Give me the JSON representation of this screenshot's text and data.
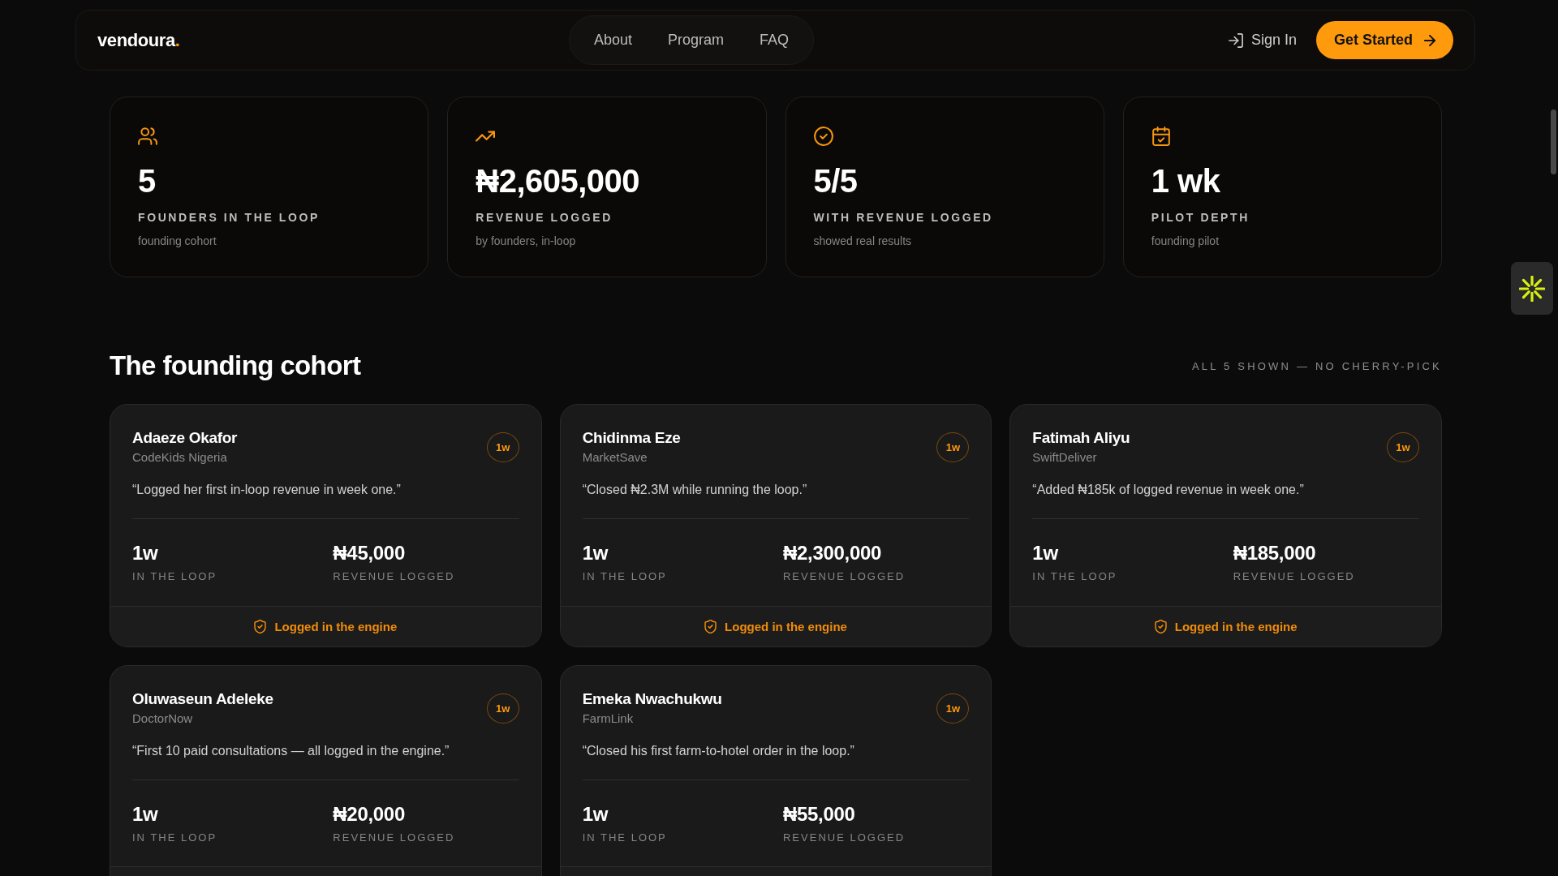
{
  "nav": {
    "logo": {
      "text": "vendoura",
      "mark": "."
    },
    "links": [
      {
        "label": "About"
      },
      {
        "label": "Program"
      },
      {
        "label": "FAQ"
      }
    ],
    "sign_in": "Sign In",
    "cta": "Get Started"
  },
  "stats": [
    {
      "value": "5",
      "label": "FOUNDERS IN THE LOOP",
      "sub": "founding cohort"
    },
    {
      "value": "₦2,605,000",
      "label": "REVENUE LOGGED",
      "sub": "by founders, in-loop"
    },
    {
      "value": "5/5",
      "label": "WITH REVENUE LOGGED",
      "sub": "showed real results"
    },
    {
      "value": "1 wk",
      "label": "PILOT DEPTH",
      "sub": "founding pilot"
    }
  ],
  "cohort": {
    "title": "The founding cohort",
    "note": "ALL 5 SHOWN — NO CHERRY-PICK",
    "founders": [
      {
        "name": "Adaeze Okafor",
        "company": "CodeKids Nigeria",
        "badge": "1w",
        "quote": "“Logged her first in-loop revenue in week one.”",
        "stats": [
          {
            "value": "1w",
            "label": "IN THE LOOP"
          },
          {
            "value": "₦45,000",
            "label": "REVENUE LOGGED"
          }
        ],
        "footer": "Logged in the engine"
      },
      {
        "name": "Chidinma Eze",
        "company": "MarketSave",
        "badge": "1w",
        "quote": "“Closed ₦2.3M while running the loop.”",
        "stats": [
          {
            "value": "1w",
            "label": "IN THE LOOP"
          },
          {
            "value": "₦2,300,000",
            "label": "REVENUE LOGGED"
          }
        ],
        "footer": "Logged in the engine"
      },
      {
        "name": "Fatimah Aliyu",
        "company": "SwiftDeliver",
        "badge": "1w",
        "quote": "“Added ₦185k of logged revenue in week one.”",
        "stats": [
          {
            "value": "1w",
            "label": "IN THE LOOP"
          },
          {
            "value": "₦185,000",
            "label": "REVENUE LOGGED"
          }
        ],
        "footer": "Logged in the engine"
      },
      {
        "name": "Oluwaseun Adeleke",
        "company": "DoctorNow",
        "badge": "1w",
        "quote": "“First 10 paid consultations — all logged in the engine.”",
        "stats": [
          {
            "value": "1w",
            "label": "IN THE LOOP"
          },
          {
            "value": "₦20,000",
            "label": "REVENUE LOGGED"
          }
        ]
      },
      {
        "name": "Emeka Nwachukwu",
        "company": "FarmLink",
        "badge": "1w",
        "quote": "“Closed his first farm-to-hotel order in the loop.”",
        "stats": [
          {
            "value": "1w",
            "label": "IN THE LOOP"
          },
          {
            "value": "₦55,000",
            "label": "REVENUE LOGGED"
          }
        ]
      }
    ]
  }
}
